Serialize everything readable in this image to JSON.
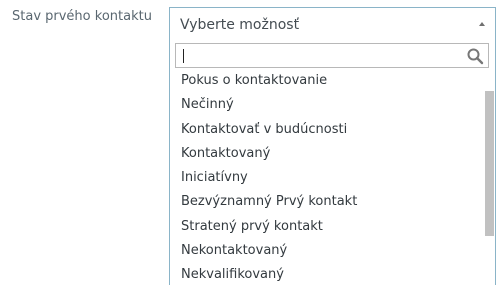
{
  "field": {
    "label": "Stav prvého kontaktu",
    "selected_value": "Vyberte možnosť"
  },
  "dropdown": {
    "search_value": "",
    "search_icon": "magnifier-icon",
    "options": [
      "Pokus o kontaktovanie",
      "Nečinný",
      "Kontaktovať v budúcnosti",
      "Kontaktovaný",
      "Iniciatívny",
      "Bezvýznamný Prvý kontakt",
      "Stratený prvý kontakt",
      "Nekontaktovaný",
      "Nekvalifikovaný"
    ]
  },
  "colors": {
    "border_accent": "#8ab4c8",
    "text": "#333a3f",
    "label": "#5a6770",
    "scrollbar_thumb": "#c1c1c1"
  }
}
